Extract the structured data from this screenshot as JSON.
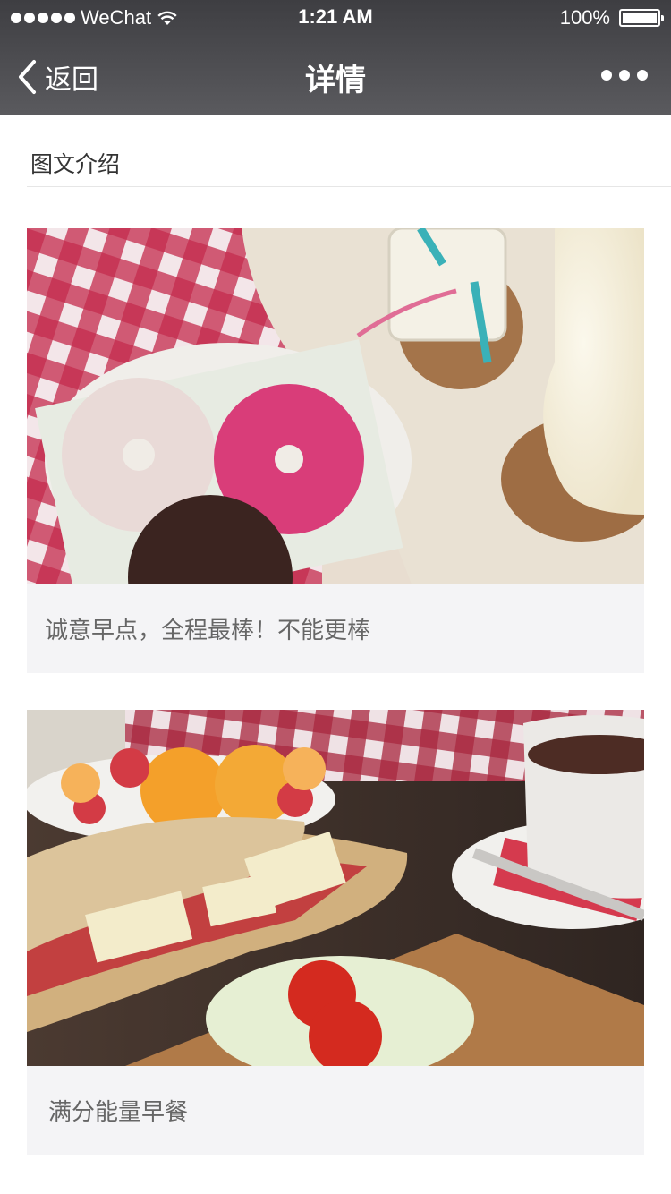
{
  "status_bar": {
    "carrier": "WeChat",
    "time": "1:21 AM",
    "battery": "100%",
    "battery_level": 1.0
  },
  "nav": {
    "back_label": "返回",
    "title": "详情",
    "more_icon": "more-dots-icon"
  },
  "section": {
    "title": "图文介绍"
  },
  "cards": [
    {
      "caption": "诚意早点，全程最棒！不能更棒",
      "image": "donuts-and-milk-photo"
    },
    {
      "caption": "满分能量早餐",
      "image": "sandwich-and-tea-photo"
    }
  ]
}
